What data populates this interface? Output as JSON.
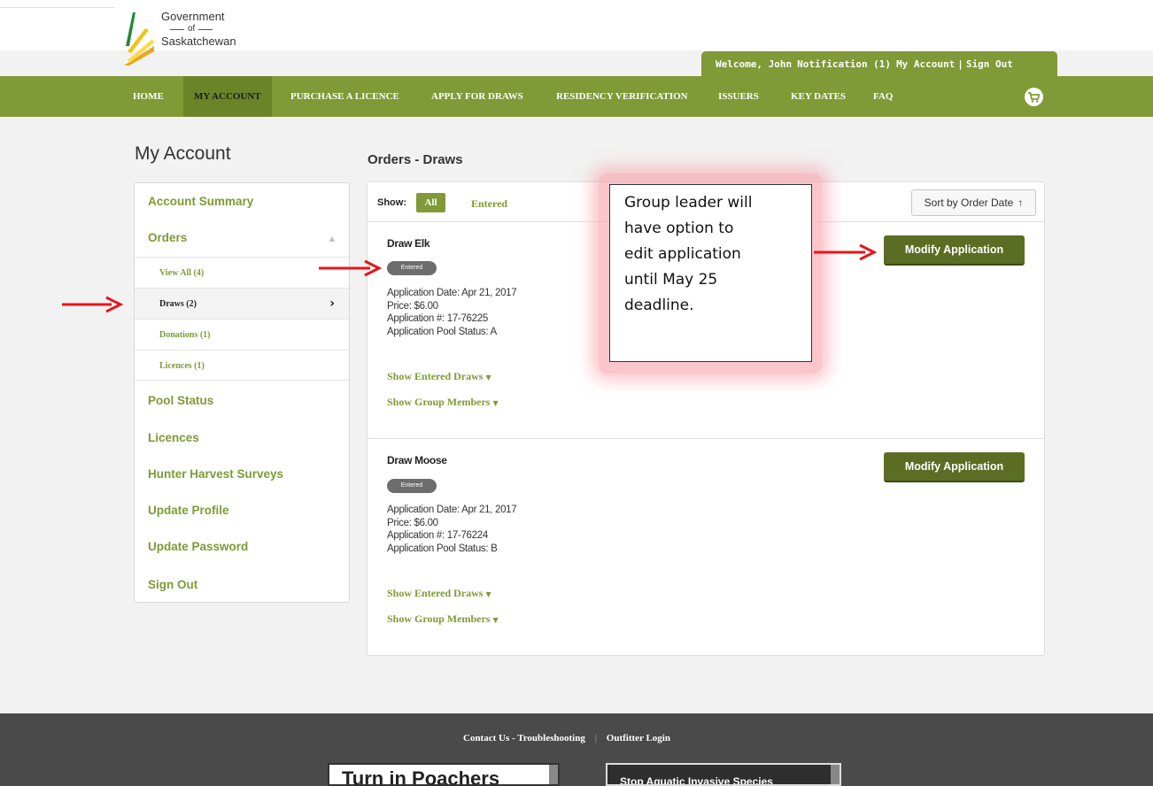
{
  "header": {
    "logo": {
      "line1": "Government",
      "line2": "of",
      "line3": "Saskatchewan"
    },
    "welcome_bar": {
      "welcome": "Welcome, John",
      "notification": "Notification (1)",
      "my_account": "My Account",
      "separator": "|",
      "sign_out": "Sign Out"
    }
  },
  "nav": {
    "items": [
      {
        "label": "HOME"
      },
      {
        "label": "MY ACCOUNT"
      },
      {
        "label": "PURCHASE A LICENCE"
      },
      {
        "label": "APPLY FOR DRAWS"
      },
      {
        "label": "RESIDENCY VERIFICATION"
      },
      {
        "label": "ISSUERS"
      },
      {
        "label": "KEY DATES"
      },
      {
        "label": "FAQ"
      }
    ],
    "active": "MY ACCOUNT",
    "cart_icon": "shopping-cart-icon"
  },
  "sidebar": {
    "title": "My Account",
    "items": [
      {
        "label": "Account Summary"
      },
      {
        "label": "Orders"
      },
      {
        "label": "Pool Status"
      },
      {
        "label": "Licences"
      },
      {
        "label": "Hunter Harvest Surveys"
      },
      {
        "label": "Update Profile"
      },
      {
        "label": "Update Password"
      },
      {
        "label": "Sign Out"
      }
    ],
    "order_sub_items": [
      {
        "label": "View All (4)"
      },
      {
        "label": "Draws (2)"
      },
      {
        "label": "Donations (1)"
      },
      {
        "label": "Licences (1)"
      }
    ],
    "active_sub_item": "Draws (2)"
  },
  "main": {
    "title": "Orders - Draws",
    "filter": {
      "label": "Show:",
      "all": "All",
      "entered": "Entered",
      "selected": "All"
    },
    "sort_button": "Sort by Order Date",
    "draws": [
      {
        "title": "Draw Elk",
        "status": "Entered",
        "application_date": "Application Date: Apr 21, 2017",
        "price": "Price: $6.00",
        "application_number": "Application #: 17-76225",
        "pool_status": "Application Pool Status: A",
        "show_entered": "Show Entered Draws",
        "show_members": "Show Group Members",
        "button": "Modify Application"
      },
      {
        "title": "Draw Moose",
        "status": "Entered",
        "application_date": "Application Date: Apr 21, 2017",
        "price": "Price: $6.00",
        "application_number": "Application #: 17-76224",
        "pool_status": "Application Pool Status: B",
        "show_entered": "Show Entered Draws",
        "show_members": "Show Group Members",
        "button": "Modify Application"
      }
    ]
  },
  "callout": {
    "lines": [
      "Group leader will",
      "have option to",
      "edit application",
      "until May 25",
      "deadline."
    ]
  },
  "footer": {
    "contact": "Contact Us - Troubleshooting",
    "separator": "|",
    "outfitter": "Outfitter Login",
    "banner1": "Turn in Poachers",
    "banner2": "Stop Aquatic Invasive Species"
  },
  "colors": {
    "brand_green": "#7f9a36",
    "dark_green_button": "#5b6d22",
    "annotation_red": "#e8141b",
    "footer_bg": "#4a4a4a"
  }
}
